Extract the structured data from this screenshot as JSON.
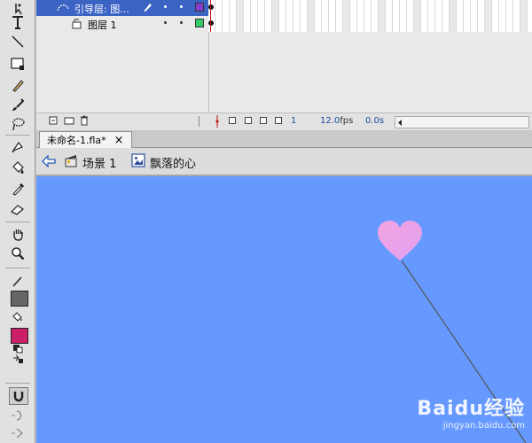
{
  "timeline": {
    "layers": [
      {
        "name": "引导层: 图...",
        "selected": true,
        "color": "#8a3ccc"
      },
      {
        "name": "图层 1",
        "selected": false,
        "color": "#33cc66"
      }
    ],
    "current_frame": "1",
    "frame_rate": "12.0",
    "frame_rate_unit": "fps",
    "elapsed_time": "0.0s"
  },
  "document": {
    "tab_label": "未命名-1.fla*",
    "close_glyph": "×"
  },
  "edit_bar": {
    "scene_label": "场景 1",
    "symbol_label": "飘落的心"
  },
  "stage": {
    "background_color": "#6699ff",
    "heart_color": "#ee9fe0",
    "guide_line_color": "#555555"
  },
  "watermark": {
    "brand": "Baidu经验",
    "url": "jingyan.baidu.com"
  },
  "colors": {
    "stroke_swatch": "#666666",
    "fill_swatch": "#cc1f6a"
  },
  "icons": {
    "tools": [
      "subselect-icon",
      "text-icon",
      "line-icon",
      "rectangle-icon",
      "pencil-icon",
      "brush-icon",
      "lasso-icon",
      "pen-icon",
      "paint-bucket-icon",
      "eyedropper-icon",
      "eraser-icon",
      "hand-icon",
      "zoom-icon",
      "stroke-color-icon",
      "fill-color-icon",
      "swap-colors-icon",
      "snap-magnet-icon",
      "smooth-icon",
      "straighten-icon"
    ]
  }
}
